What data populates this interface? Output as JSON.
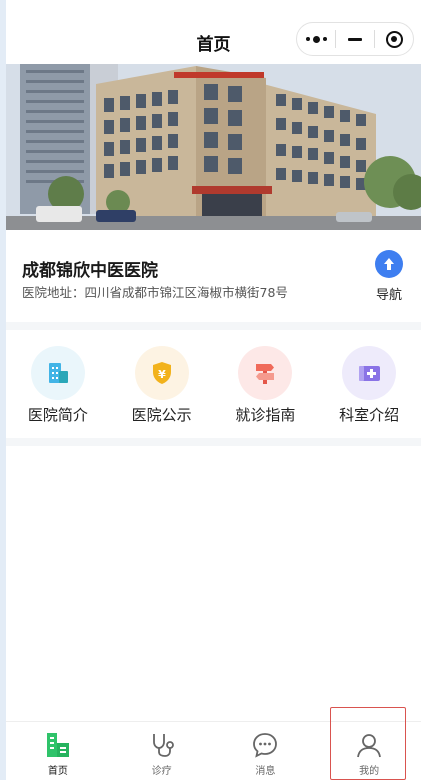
{
  "navbar": {
    "title": "首页"
  },
  "hospital": {
    "name": "成都锦欣中医医院",
    "address": "医院地址：四川省成都市锦江区海椒市横街78号",
    "nav_label": "导航"
  },
  "menu": [
    {
      "label": "医院简介",
      "icon": "building-icon",
      "bg": "#eaf6fb",
      "color": "#42b4e6"
    },
    {
      "label": "医院公示",
      "icon": "shield-yen-icon",
      "bg": "#fdf3e3",
      "color": "#f2b21c"
    },
    {
      "label": "就诊指南",
      "icon": "signpost-icon",
      "bg": "#fde8e7",
      "color": "#f06a5a"
    },
    {
      "label": "科室介绍",
      "icon": "medical-card-icon",
      "bg": "#eeebfb",
      "color": "#8a73e6"
    }
  ],
  "tabs": [
    {
      "label": "首页",
      "icon": "home-building-icon"
    },
    {
      "label": "诊疗",
      "icon": "stethoscope-icon"
    },
    {
      "label": "消息",
      "icon": "chat-icon"
    },
    {
      "label": "我的",
      "icon": "user-icon"
    }
  ],
  "colors": {
    "accent": "#3e7ef0",
    "active_tab": "#2fc36a",
    "highlight": "#d9534f"
  }
}
